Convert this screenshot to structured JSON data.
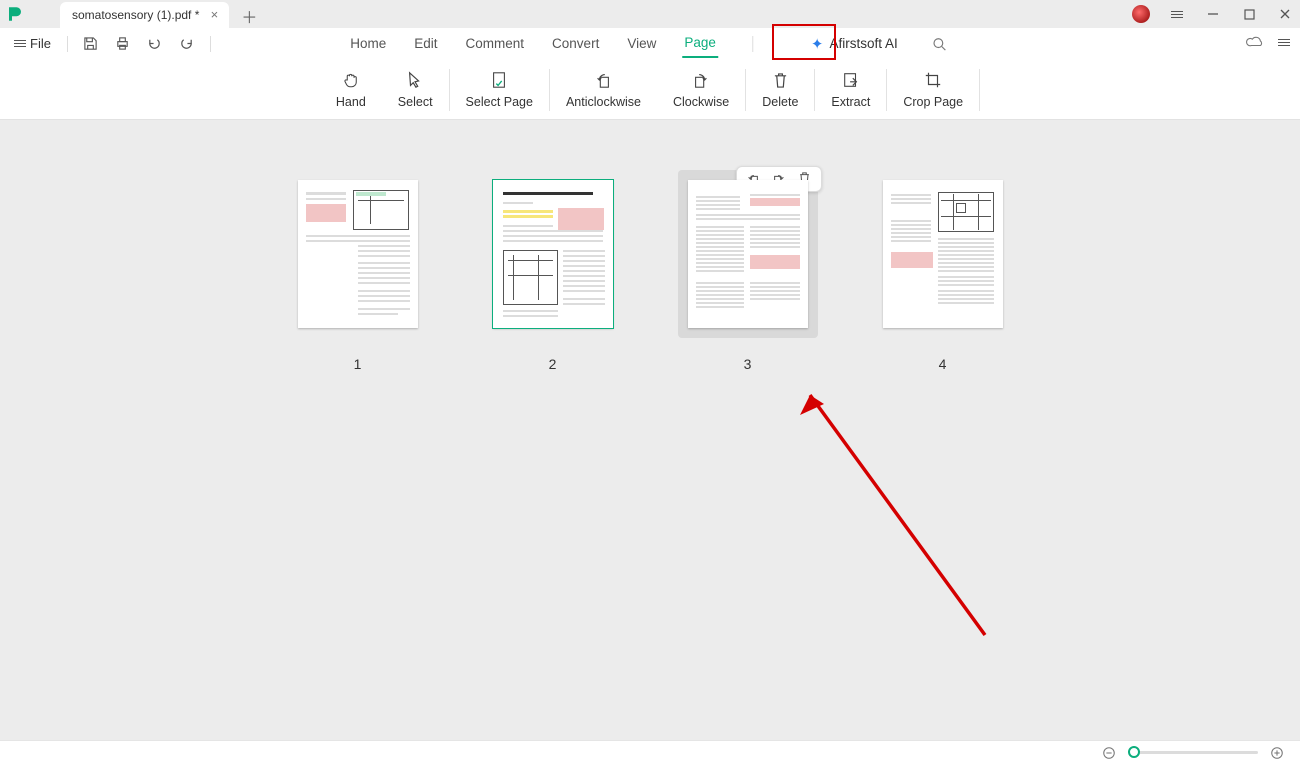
{
  "tab": {
    "title": "somatosensory (1).pdf *"
  },
  "file_menu": {
    "label": "File"
  },
  "main_menu": {
    "items": [
      "Home",
      "Edit",
      "Comment",
      "Convert",
      "View",
      "Page"
    ],
    "active_index": 5
  },
  "ai": {
    "label": "Afirstsoft AI"
  },
  "ribbon": {
    "tools": [
      {
        "id": "hand",
        "label": "Hand"
      },
      {
        "id": "select",
        "label": "Select"
      },
      {
        "id": "select-page",
        "label": "Select Page"
      },
      {
        "id": "anticlockwise",
        "label": "Anticlockwise"
      },
      {
        "id": "clockwise",
        "label": "Clockwise"
      },
      {
        "id": "delete",
        "label": "Delete"
      },
      {
        "id": "extract",
        "label": "Extract"
      },
      {
        "id": "crop-page",
        "label": "Crop Page"
      }
    ],
    "separators_after": [
      1,
      2,
      4,
      5,
      6
    ]
  },
  "pages": {
    "labels": [
      "1",
      "2",
      "3",
      "4"
    ],
    "selected_index": 2,
    "outlined_index": 1
  },
  "mini_toolbar": {
    "items": [
      "rotate-left-icon",
      "rotate-right-icon",
      "trash-icon"
    ]
  },
  "highlight_box": {
    "target": "main-menu-page"
  },
  "arrow": {
    "from": "bottom-right-workspace",
    "to": "page-3-thumbnail"
  }
}
